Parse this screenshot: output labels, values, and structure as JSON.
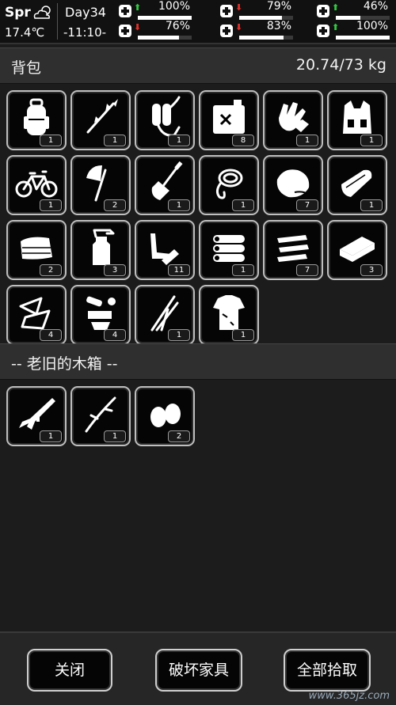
{
  "status": {
    "season": "Spr",
    "temperature": "17.4℃",
    "day": "Day34",
    "time": "-11:10-",
    "stats": [
      {
        "name": "health",
        "icon": "medkit-icon",
        "trend": "up",
        "value": "100%",
        "level": 1.0
      },
      {
        "name": "hunger",
        "icon": "stomach-icon",
        "trend": "down",
        "value": "79%",
        "level": 0.79
      },
      {
        "name": "energy",
        "icon": "battery-icon",
        "trend": "up",
        "value": "46%",
        "level": 0.46
      },
      {
        "name": "stamina",
        "icon": "boot-icon",
        "trend": "down",
        "value": "76%",
        "level": 0.76
      },
      {
        "name": "thirst",
        "icon": "water-drop-icon",
        "trend": "down",
        "value": "83%",
        "level": 0.83
      },
      {
        "name": "mood",
        "icon": "heart-icon",
        "trend": "up",
        "value": "100%",
        "level": 1.0
      }
    ],
    "arrow_up": "⬆",
    "arrow_down": "⬇"
  },
  "backpack": {
    "title": "背包",
    "weight": "20.74/73 kg",
    "items": [
      {
        "icon": "backpack-icon",
        "count": "1"
      },
      {
        "icon": "spear-icon",
        "count": "1"
      },
      {
        "icon": "oxygen-tank-icon",
        "count": "1"
      },
      {
        "icon": "fuel-can-icon",
        "count": "8"
      },
      {
        "icon": "gloves-icon",
        "count": "1"
      },
      {
        "icon": "tactical-vest-icon",
        "count": "1"
      },
      {
        "icon": "bicycle-icon",
        "count": "1"
      },
      {
        "icon": "axe-icon",
        "count": "2"
      },
      {
        "icon": "shovel-icon",
        "count": "1"
      },
      {
        "icon": "rope-icon",
        "count": "1"
      },
      {
        "icon": "meat-icon",
        "count": "7"
      },
      {
        "icon": "bread-icon",
        "count": "1"
      },
      {
        "icon": "cloth-icon",
        "count": "2"
      },
      {
        "icon": "spray-bottle-icon",
        "count": "3"
      },
      {
        "icon": "pipes-icon",
        "count": "11"
      },
      {
        "icon": "logs-icon",
        "count": "1"
      },
      {
        "icon": "planks-icon",
        "count": "7"
      },
      {
        "icon": "brick-icon",
        "count": "3"
      },
      {
        "icon": "glass-shards-icon",
        "count": "4"
      },
      {
        "icon": "scrap-parts-icon",
        "count": "4"
      },
      {
        "icon": "reeds-icon",
        "count": "1"
      },
      {
        "icon": "ragged-shirt-icon",
        "count": "1"
      }
    ]
  },
  "container": {
    "title": "-- 老旧的木箱 --",
    "items": [
      {
        "icon": "rifle-icon",
        "count": "1"
      },
      {
        "icon": "branch-icon",
        "count": "1"
      },
      {
        "icon": "eggs-icon",
        "count": "2"
      }
    ]
  },
  "buttons": {
    "close": "关闭",
    "destroy": "破坏家具",
    "take_all": "全部拾取"
  },
  "watermark": "www.365jz.com",
  "colors": {
    "up": "#2ecc40",
    "down": "#e0302a",
    "slot_border": "#bfbfbf"
  }
}
